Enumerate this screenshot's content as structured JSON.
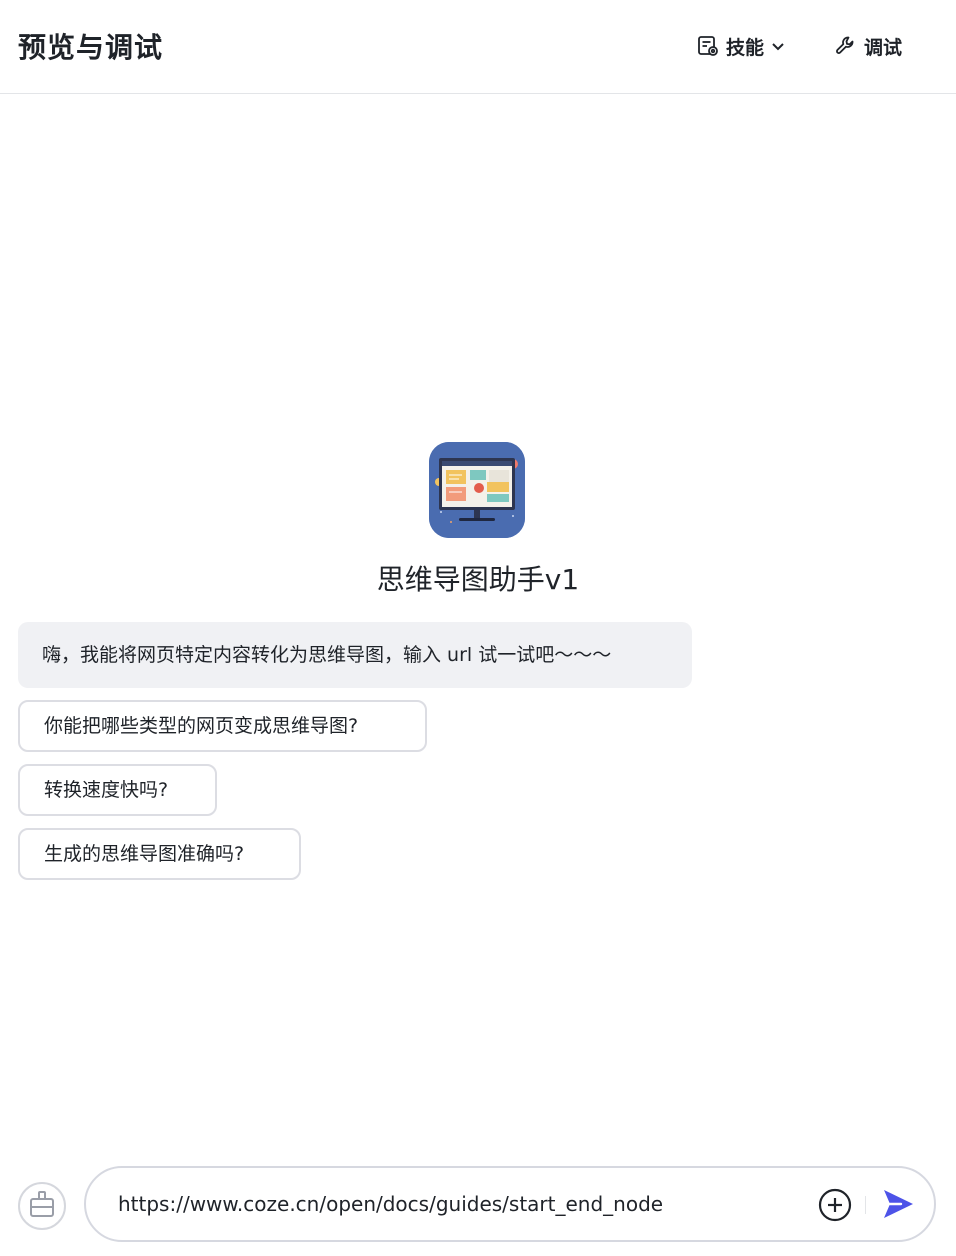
{
  "header": {
    "title": "预览与调试",
    "skills_label": "技能",
    "debug_label": "调试"
  },
  "bot": {
    "name": "思维导图助手v1"
  },
  "chat": {
    "welcome_message": "嗨，我能将网页特定内容转化为思维导图，输入 url 试一试吧～～～",
    "suggestions": [
      "你能把哪些类型的网页变成思维导图?",
      "转换速度快吗?",
      "生成的思维导图准确吗?"
    ]
  },
  "input": {
    "value": "https://www.coze.cn/open/docs/guides/start_end_node"
  },
  "colors": {
    "accent": "#4d53e8",
    "avatar_bg": "#4a6cb0",
    "bubble_bg": "#f0f1f4",
    "border": "#dcdde3"
  },
  "icons": {
    "skills": "skills-doc-icon",
    "skills_dropdown": "chevron-down-icon",
    "debug": "wrench-icon",
    "clear": "broom-icon",
    "add": "plus-circle-icon",
    "send": "send-icon"
  }
}
